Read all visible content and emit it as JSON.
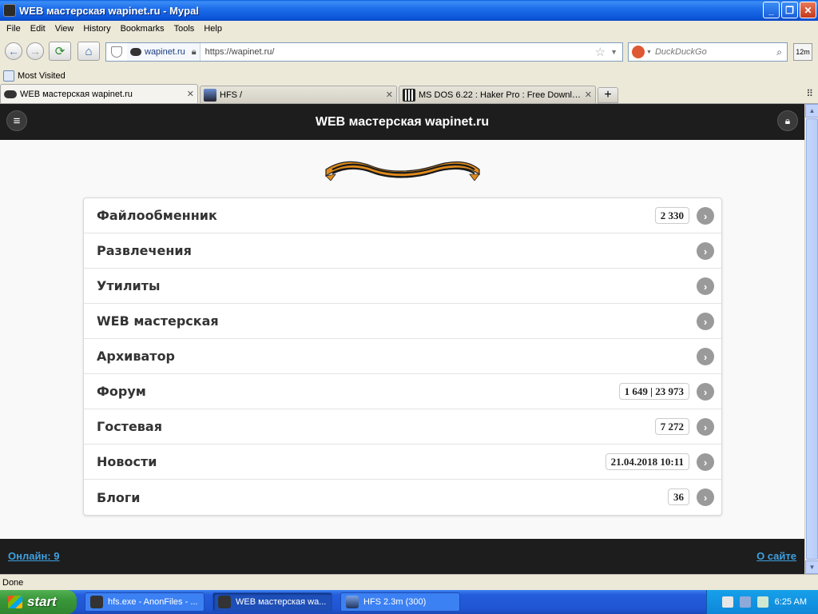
{
  "window": {
    "title": "WEB мастерская wapinet.ru - Mypal"
  },
  "menu": [
    "File",
    "Edit",
    "View",
    "History",
    "Bookmarks",
    "Tools",
    "Help"
  ],
  "nav": {
    "identity_site": "wapinet.ru",
    "url": "https://wapinet.ru/",
    "search_placeholder": "DuckDuckGo",
    "zoom_badge": "12m"
  },
  "bookmarks": {
    "most_visited": "Most Visited"
  },
  "tabs": [
    {
      "label": "WEB мастерская wapinet.ru",
      "active": true
    },
    {
      "label": "HFS /",
      "active": false
    },
    {
      "label": "MS DOS 6.22 : Haker Pro : Free Downloa...",
      "active": false
    }
  ],
  "site": {
    "title": "WEB мастерская wapinet.ru",
    "menu": [
      {
        "label": "Файлообменник",
        "count": "2 330"
      },
      {
        "label": "Развлечения",
        "count": ""
      },
      {
        "label": "Утилиты",
        "count": ""
      },
      {
        "label": "WEB мастерская",
        "count": ""
      },
      {
        "label": "Архиватор",
        "count": ""
      },
      {
        "label": "Форум",
        "count": "1 649 | 23 973"
      },
      {
        "label": "Гостевая",
        "count": "7 272"
      },
      {
        "label": "Новости",
        "count": "21.04.2018 10:11"
      },
      {
        "label": "Блоги",
        "count": "36"
      }
    ],
    "footer": {
      "online": "Онлайн: 9",
      "about": "О сайте"
    }
  },
  "status": "Done",
  "taskbar": {
    "start": "start",
    "tasks": [
      {
        "label": "hfs.exe - AnonFiles - ...",
        "active": false
      },
      {
        "label": "WEB мастерская wa...",
        "active": true
      },
      {
        "label": "HFS 2.3m (300)",
        "active": false
      }
    ],
    "clock": "6:25 AM"
  },
  "colors": {
    "header_bg": "#1d1d1d",
    "link_blue": "#3fa0e0",
    "titlebar_blue": "#0B55D8"
  }
}
